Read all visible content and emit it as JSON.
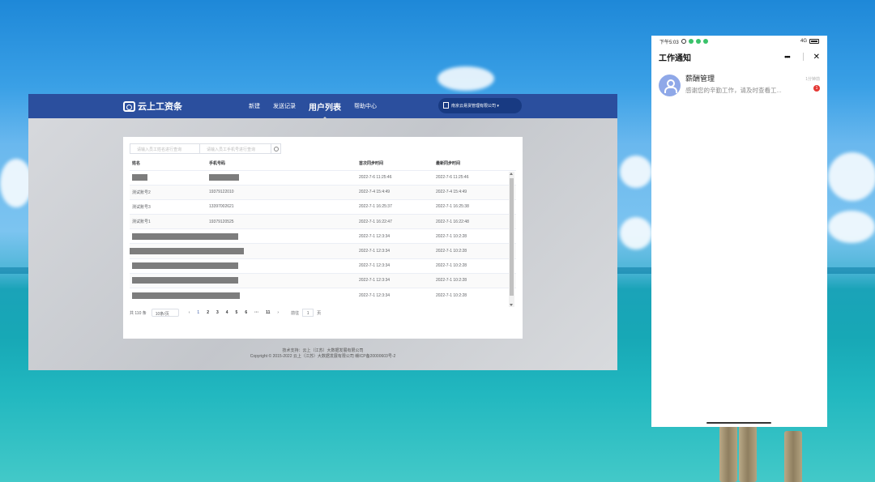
{
  "web": {
    "logo_text": "云上工资条",
    "nav": [
      {
        "label": "新建",
        "active": false
      },
      {
        "label": "发送记录",
        "active": false
      },
      {
        "label": "用户列表",
        "active": true
      },
      {
        "label": "帮助中心",
        "active": false
      }
    ],
    "org_name": "南京云易货管理有限公司 ▾",
    "search": {
      "placeholder_name": "请输入员工姓名进行查询",
      "placeholder_phone": "请输入员工手机号进行查询"
    },
    "table": {
      "headers": [
        "姓名",
        "手机号码",
        "首次同步时间",
        "最新同步时间"
      ],
      "rows": [
        {
          "name": "",
          "phone": "",
          "first": "2022-7-6 11:25:46",
          "last": "2022-7-6 11:25:46"
        },
        {
          "name": "测试账号2",
          "phone": "19379122010",
          "first": "2022-7-4 15:4:49",
          "last": "2022-7-4 15:4:49"
        },
        {
          "name": "测试账号3",
          "phone": "13397002621",
          "first": "2022-7-1 16:25:37",
          "last": "2022-7-1 16:25:38"
        },
        {
          "name": "测试账号1",
          "phone": "19379120525",
          "first": "2022-7-1 16:22:47",
          "last": "2022-7-1 16:22:48"
        },
        {
          "name": "",
          "phone": "",
          "first": "2022-7-1 12:3:34",
          "last": "2022-7-1 10:2:28"
        },
        {
          "name": "",
          "phone": "",
          "first": "2022-7-1 12:3:34",
          "last": "2022-7-1 10:2:28"
        },
        {
          "name": "",
          "phone": "",
          "first": "2022-7-1 12:3:34",
          "last": "2022-7-1 10:2:28"
        },
        {
          "name": "",
          "phone": "",
          "first": "2022-7-1 12:3:34",
          "last": "2022-7-1 10:2:28"
        },
        {
          "name": "",
          "phone": "",
          "first": "2022-7-1 12:3:34",
          "last": "2022-7-1 10:2:28"
        }
      ]
    },
    "pager": {
      "total": "共 110 条",
      "page_size": "10条/页",
      "prev": "‹",
      "pages": [
        "1",
        "2",
        "3",
        "4",
        "5",
        "6",
        "···",
        "11"
      ],
      "next": "›",
      "goto_label": "前往",
      "goto_value": "1",
      "goto_suffix": "页"
    },
    "footer": {
      "line1": "技术支持：云上（江苏）大数据发展有限公司",
      "line2": "Copyright © 2015-2022 云上（江苏）大数据发展有限公司 赣ICP备20000603号-2"
    }
  },
  "phone": {
    "status_time": "下午5:03",
    "status_right": "4G",
    "header_title": "工作通知",
    "more": "•••",
    "close": "✕",
    "notice": {
      "name": "薪酬管理",
      "message": "感谢您的辛勤工作，请及时查看工...",
      "time": "1分钟前",
      "badge": "1"
    }
  }
}
